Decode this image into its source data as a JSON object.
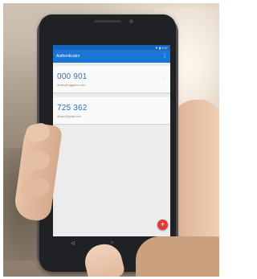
{
  "app": {
    "title": "Authenticator",
    "status_icons": "▼ ▮ 9:37"
  },
  "accounts": [
    {
      "code": "000 901",
      "account": "ashley@uggplanc.com"
    },
    {
      "code": "725 362",
      "account": "lithope@gmail.com"
    }
  ],
  "icons": {
    "menu": "more-vert-icon",
    "add": "add-icon",
    "back": "back-icon",
    "home": "home-icon",
    "recents": "recents-icon"
  },
  "colors": {
    "app_bar": "#1976d2",
    "code_text": "#2a6fc9",
    "fab": "#e53935"
  }
}
